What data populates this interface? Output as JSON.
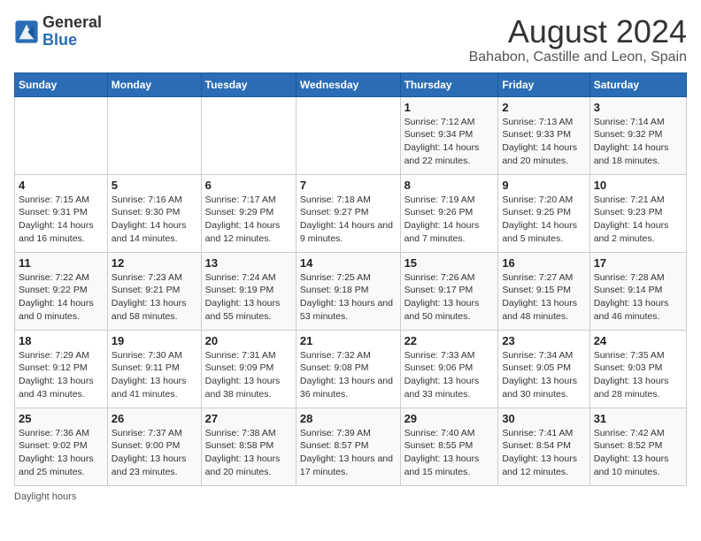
{
  "logo": {
    "line1": "General",
    "line2": "Blue"
  },
  "header": {
    "title": "August 2024",
    "subtitle": "Bahabon, Castille and Leon, Spain"
  },
  "weekdays": [
    "Sunday",
    "Monday",
    "Tuesday",
    "Wednesday",
    "Thursday",
    "Friday",
    "Saturday"
  ],
  "weeks": [
    [
      {
        "day": "",
        "info": ""
      },
      {
        "day": "",
        "info": ""
      },
      {
        "day": "",
        "info": ""
      },
      {
        "day": "",
        "info": ""
      },
      {
        "day": "1",
        "info": "Sunrise: 7:12 AM\nSunset: 9:34 PM\nDaylight: 14 hours and 22 minutes."
      },
      {
        "day": "2",
        "info": "Sunrise: 7:13 AM\nSunset: 9:33 PM\nDaylight: 14 hours and 20 minutes."
      },
      {
        "day": "3",
        "info": "Sunrise: 7:14 AM\nSunset: 9:32 PM\nDaylight: 14 hours and 18 minutes."
      }
    ],
    [
      {
        "day": "4",
        "info": "Sunrise: 7:15 AM\nSunset: 9:31 PM\nDaylight: 14 hours and 16 minutes."
      },
      {
        "day": "5",
        "info": "Sunrise: 7:16 AM\nSunset: 9:30 PM\nDaylight: 14 hours and 14 minutes."
      },
      {
        "day": "6",
        "info": "Sunrise: 7:17 AM\nSunset: 9:29 PM\nDaylight: 14 hours and 12 minutes."
      },
      {
        "day": "7",
        "info": "Sunrise: 7:18 AM\nSunset: 9:27 PM\nDaylight: 14 hours and 9 minutes."
      },
      {
        "day": "8",
        "info": "Sunrise: 7:19 AM\nSunset: 9:26 PM\nDaylight: 14 hours and 7 minutes."
      },
      {
        "day": "9",
        "info": "Sunrise: 7:20 AM\nSunset: 9:25 PM\nDaylight: 14 hours and 5 minutes."
      },
      {
        "day": "10",
        "info": "Sunrise: 7:21 AM\nSunset: 9:23 PM\nDaylight: 14 hours and 2 minutes."
      }
    ],
    [
      {
        "day": "11",
        "info": "Sunrise: 7:22 AM\nSunset: 9:22 PM\nDaylight: 14 hours and 0 minutes."
      },
      {
        "day": "12",
        "info": "Sunrise: 7:23 AM\nSunset: 9:21 PM\nDaylight: 13 hours and 58 minutes."
      },
      {
        "day": "13",
        "info": "Sunrise: 7:24 AM\nSunset: 9:19 PM\nDaylight: 13 hours and 55 minutes."
      },
      {
        "day": "14",
        "info": "Sunrise: 7:25 AM\nSunset: 9:18 PM\nDaylight: 13 hours and 53 minutes."
      },
      {
        "day": "15",
        "info": "Sunrise: 7:26 AM\nSunset: 9:17 PM\nDaylight: 13 hours and 50 minutes."
      },
      {
        "day": "16",
        "info": "Sunrise: 7:27 AM\nSunset: 9:15 PM\nDaylight: 13 hours and 48 minutes."
      },
      {
        "day": "17",
        "info": "Sunrise: 7:28 AM\nSunset: 9:14 PM\nDaylight: 13 hours and 46 minutes."
      }
    ],
    [
      {
        "day": "18",
        "info": "Sunrise: 7:29 AM\nSunset: 9:12 PM\nDaylight: 13 hours and 43 minutes."
      },
      {
        "day": "19",
        "info": "Sunrise: 7:30 AM\nSunset: 9:11 PM\nDaylight: 13 hours and 41 minutes."
      },
      {
        "day": "20",
        "info": "Sunrise: 7:31 AM\nSunset: 9:09 PM\nDaylight: 13 hours and 38 minutes."
      },
      {
        "day": "21",
        "info": "Sunrise: 7:32 AM\nSunset: 9:08 PM\nDaylight: 13 hours and 36 minutes."
      },
      {
        "day": "22",
        "info": "Sunrise: 7:33 AM\nSunset: 9:06 PM\nDaylight: 13 hours and 33 minutes."
      },
      {
        "day": "23",
        "info": "Sunrise: 7:34 AM\nSunset: 9:05 PM\nDaylight: 13 hours and 30 minutes."
      },
      {
        "day": "24",
        "info": "Sunrise: 7:35 AM\nSunset: 9:03 PM\nDaylight: 13 hours and 28 minutes."
      }
    ],
    [
      {
        "day": "25",
        "info": "Sunrise: 7:36 AM\nSunset: 9:02 PM\nDaylight: 13 hours and 25 minutes."
      },
      {
        "day": "26",
        "info": "Sunrise: 7:37 AM\nSunset: 9:00 PM\nDaylight: 13 hours and 23 minutes."
      },
      {
        "day": "27",
        "info": "Sunrise: 7:38 AM\nSunset: 8:58 PM\nDaylight: 13 hours and 20 minutes."
      },
      {
        "day": "28",
        "info": "Sunrise: 7:39 AM\nSunset: 8:57 PM\nDaylight: 13 hours and 17 minutes."
      },
      {
        "day": "29",
        "info": "Sunrise: 7:40 AM\nSunset: 8:55 PM\nDaylight: 13 hours and 15 minutes."
      },
      {
        "day": "30",
        "info": "Sunrise: 7:41 AM\nSunset: 8:54 PM\nDaylight: 13 hours and 12 minutes."
      },
      {
        "day": "31",
        "info": "Sunrise: 7:42 AM\nSunset: 8:52 PM\nDaylight: 13 hours and 10 minutes."
      }
    ]
  ],
  "footer": {
    "daylight_label": "Daylight hours"
  }
}
